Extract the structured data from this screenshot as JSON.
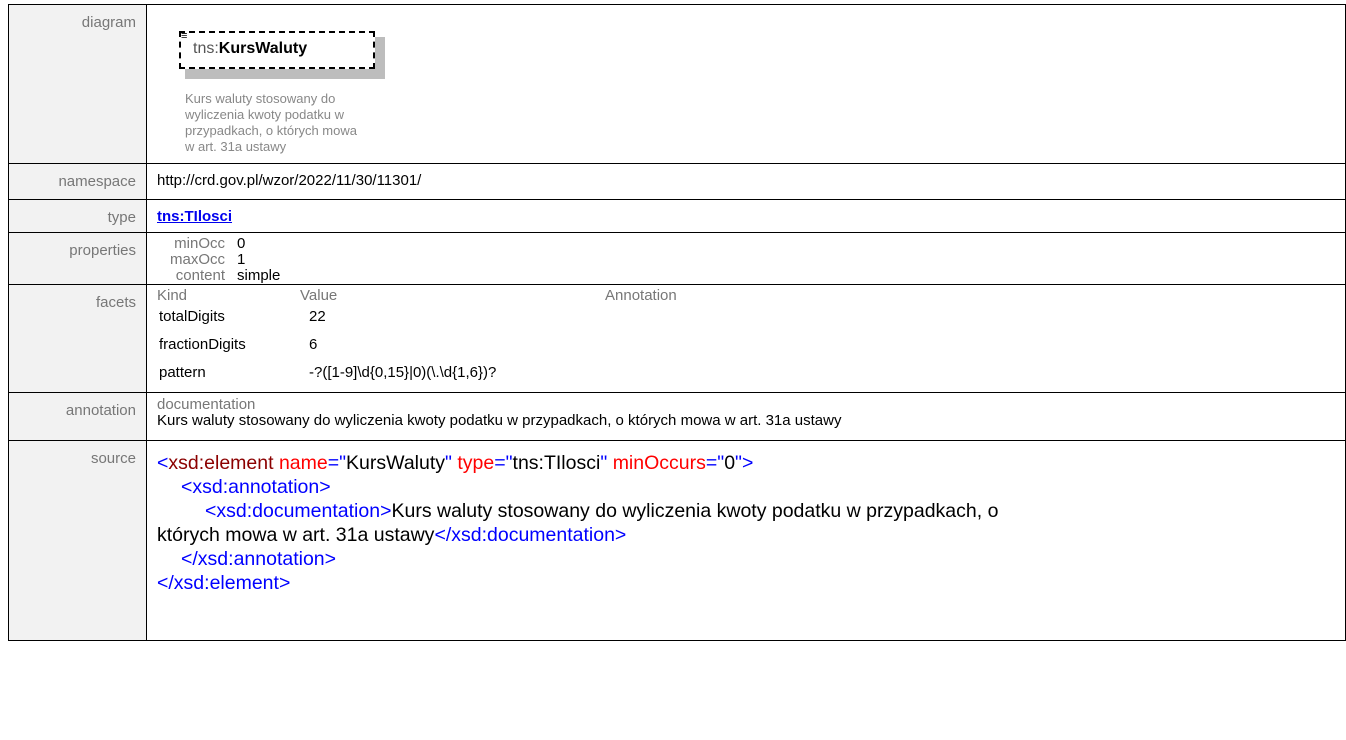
{
  "labels": {
    "diagram": "diagram",
    "namespace": "namespace",
    "type": "type",
    "properties": "properties",
    "facets": "facets",
    "annotation": "annotation",
    "source": "source"
  },
  "diagram": {
    "icon": "≡",
    "prefix": "tns:",
    "name": "KursWaluty",
    "doc_lines": [
      "Kurs waluty stosowany do",
      "wyliczenia kwoty podatku w",
      "przypadkach, o których mowa",
      "w art. 31a ustawy"
    ]
  },
  "namespace": "http://crd.gov.pl/wzor/2022/11/30/11301/",
  "type": "tns:TIlosci",
  "properties": [
    {
      "key": "minOcc",
      "value": "0"
    },
    {
      "key": "maxOcc",
      "value": "1"
    },
    {
      "key": "content",
      "value": "simple"
    }
  ],
  "facets": {
    "headers": [
      "Kind",
      "Value",
      "Annotation"
    ],
    "rows": [
      {
        "kind": "totalDigits",
        "value": "22"
      },
      {
        "kind": "fractionDigits",
        "value": "6"
      },
      {
        "kind": "pattern",
        "value": "-?([1-9]\\d{0,15}|0)(\\.\\d{1,6})?"
      }
    ]
  },
  "annotation": {
    "key": "documentation",
    "text": "Kurs waluty stosowany do wyliczenia kwoty podatku w przypadkach, o których mowa w art. 31a ustawy"
  },
  "source": {
    "l1_open": "<",
    "l1_tag": "xsd:element",
    "l1_a1": "name",
    "l1_eq1": "=\"",
    "l1_v1": "KursWaluty",
    "l1_q1": "\"",
    "l1_a2": "type",
    "l1_eq2": "=\"",
    "l1_v2": "tns:TIlosci",
    "l1_q2": "\"",
    "l1_a3": "minOccurs",
    "l1_eq3": "=\"",
    "l1_v3": "0",
    "l1_q3": "\">",
    "l2": "<xsd:annotation>",
    "l3_open": "<xsd:documentation>",
    "l3_text1": "Kurs waluty stosowany do wyliczenia kwoty podatku w przypadkach, o",
    "l4_text2": "których mowa w art. 31a ustawy",
    "l4_close": "</xsd:documentation>",
    "l5": "</xsd:annotation>",
    "l6": "</xsd:element>"
  }
}
